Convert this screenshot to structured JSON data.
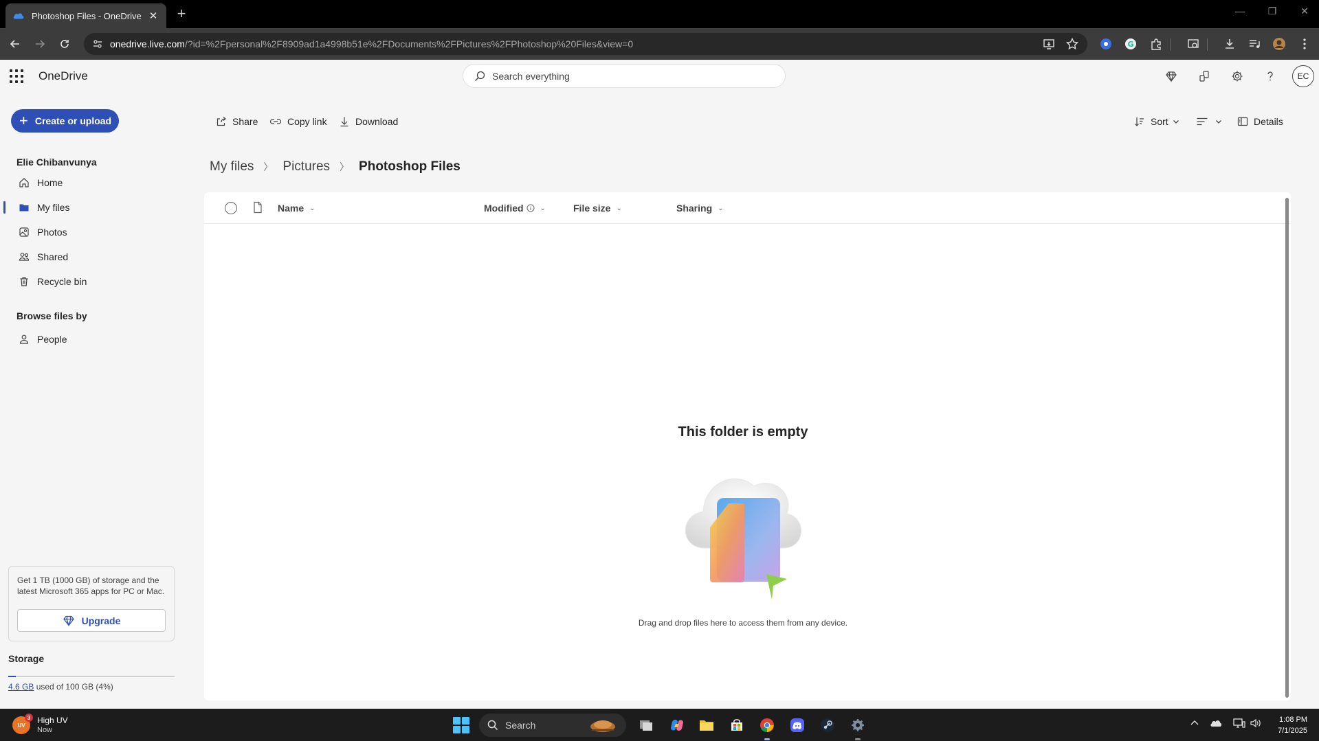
{
  "browser": {
    "tab_title": "Photoshop Files - OneDrive",
    "tab_close": "✕",
    "new_tab": "+",
    "url_host": "onedrive.live.com",
    "url_path": "/?id=%2Fpersonal%2F8909ad1a4998b51e%2FDocuments%2FPictures%2FPhotoshop%20Files&view=0"
  },
  "header": {
    "app_name": "OneDrive",
    "search_placeholder": "Search everything",
    "avatar_initials": "EC"
  },
  "sidebar": {
    "create_label": "Create or upload",
    "user_name": "Elie Chibanvunya",
    "items": [
      {
        "label": "Home",
        "icon": "home-icon"
      },
      {
        "label": "My files",
        "icon": "folder-icon",
        "active": true
      },
      {
        "label": "Photos",
        "icon": "photos-icon"
      },
      {
        "label": "Shared",
        "icon": "shared-icon"
      },
      {
        "label": "Recycle bin",
        "icon": "recycle-bin-icon"
      }
    ],
    "browse_label": "Browse files by",
    "people_label": "People",
    "upsell_text": "Get 1 TB (1000 GB) of storage and the latest Microsoft 365 apps for PC or Mac.",
    "upgrade_label": "Upgrade",
    "storage_label": "Storage",
    "storage_used": "4.6 GB",
    "storage_rest": " used of 100 GB (4%)",
    "storage_fraction": 0.046
  },
  "toolbar": {
    "share": "Share",
    "copy_link": "Copy link",
    "download": "Download",
    "sort": "Sort",
    "details": "Details"
  },
  "breadcrumb": [
    "My files",
    "Pictures",
    "Photoshop Files"
  ],
  "columns": {
    "name": "Name",
    "modified": "Modified",
    "file_size": "File size",
    "sharing": "Sharing"
  },
  "empty_state": {
    "title": "This folder is empty",
    "subtitle": "Drag and drop files here to access them from any device."
  },
  "taskbar": {
    "weather_title": "High UV",
    "weather_sub": "Now",
    "weather_badge": "3",
    "weather_icon_text": "UV",
    "search_label": "Search",
    "time": "1:08 PM",
    "date": "7/1/2025"
  },
  "colors": {
    "accent": "#2e4fb5",
    "chrome_bg": "#3c3c3c",
    "page_bg": "#f5f5f5"
  }
}
